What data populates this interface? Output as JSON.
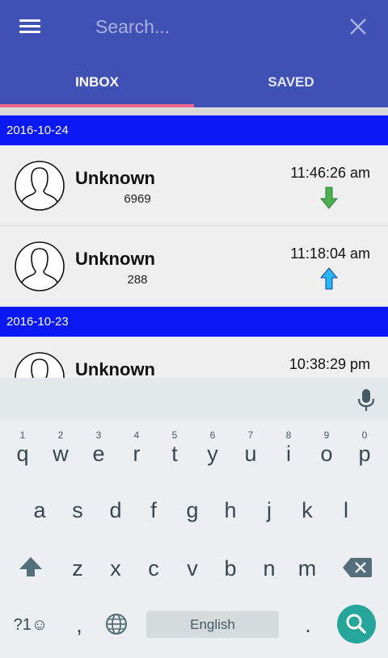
{
  "header": {
    "search_placeholder": "Search...",
    "tabs": [
      {
        "label": "INBOX",
        "active": true
      },
      {
        "label": "SAVED",
        "active": false
      }
    ]
  },
  "colors": {
    "app_bar": "#3f51b5",
    "tab_indicator": "#f06292",
    "date_header": "#0a18f3",
    "incoming_arrow": "#4caf50",
    "outgoing_arrow": "#29b6f6",
    "search_key": "#26a69a"
  },
  "groups": [
    {
      "date": "2016-10-24",
      "calls": [
        {
          "name": "Unknown",
          "number": "6969",
          "time": "11:46:26 am",
          "direction": "incoming"
        },
        {
          "name": "Unknown",
          "number": "288",
          "time": "11:18:04 am",
          "direction": "outgoing"
        }
      ]
    },
    {
      "date": "2016-10-23",
      "calls": [
        {
          "name": "Unknown",
          "number": "",
          "time": "10:38:29 pm",
          "direction": "incoming"
        }
      ]
    }
  ],
  "keyboard": {
    "row1": [
      {
        "ch": "q",
        "hint": "1"
      },
      {
        "ch": "w",
        "hint": "2"
      },
      {
        "ch": "e",
        "hint": "3"
      },
      {
        "ch": "r",
        "hint": "4"
      },
      {
        "ch": "t",
        "hint": "5"
      },
      {
        "ch": "y",
        "hint": "6"
      },
      {
        "ch": "u",
        "hint": "7"
      },
      {
        "ch": "i",
        "hint": "8"
      },
      {
        "ch": "o",
        "hint": "9"
      },
      {
        "ch": "p",
        "hint": "0"
      }
    ],
    "row2": [
      "a",
      "s",
      "d",
      "f",
      "g",
      "h",
      "j",
      "k",
      "l"
    ],
    "row3": [
      "z",
      "x",
      "c",
      "v",
      "b",
      "n",
      "m"
    ],
    "symbols_label": "?1☺",
    "comma": ",",
    "period": ".",
    "space_label": "English",
    "icons": [
      "menu-icon",
      "close-icon",
      "person-icon",
      "arrow-down-icon",
      "arrow-up-icon",
      "mic-icon",
      "shift-icon",
      "backspace-icon",
      "globe-icon",
      "search-icon"
    ]
  }
}
